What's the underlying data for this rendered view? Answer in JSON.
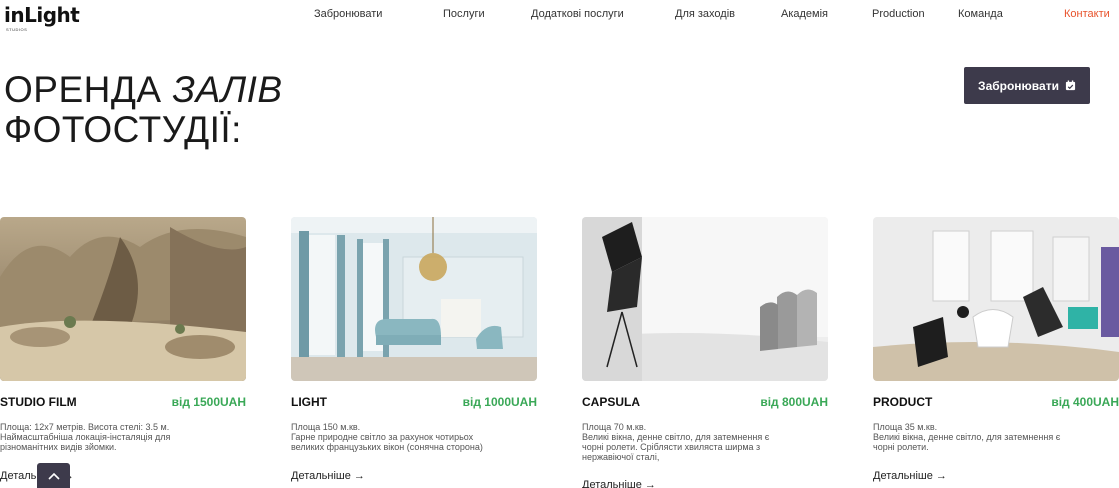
{
  "header": {
    "logo_text": "inLight",
    "logo_sub": "STUDIOS",
    "nav": [
      {
        "label": "Забронювати"
      },
      {
        "label": "Послуги"
      },
      {
        "label": "Додаткові послуги"
      },
      {
        "label": "Для заходів"
      },
      {
        "label": "Академія"
      },
      {
        "label": "Production"
      },
      {
        "label": "Команда"
      },
      {
        "label": "Контакти"
      }
    ]
  },
  "main": {
    "title_line1_a": "ОРЕНДА",
    "title_line1_b": "ЗАЛІВ",
    "title_line2": "ФОТОСТУДІЇ:",
    "cta_label": "Забронювати"
  },
  "colors": {
    "accent_dark": "#3d3a4b",
    "price_green": "#3aa857",
    "active_nav": "#e8532c"
  },
  "studios": [
    {
      "name": "STUDIO FILM",
      "price": "від 1500UAH",
      "desc": [
        "Площа: 12х7 метрів. Висота стелі: 3.5 м.",
        "Наймасштабніша локація-інсталяція для",
        "різноманітних видів зйомки."
      ],
      "more": "Детальніше →"
    },
    {
      "name": "LIGHT",
      "price": "від 1000UAH",
      "desc": [
        "Площа 150 м.кв.",
        "Гарне природне світло за рахунок чотирьох",
        "великих французьких вікон (сонячна сторона)"
      ],
      "more": "Детальніше →"
    },
    {
      "name": "CAPSULA",
      "price": "від 800UAH",
      "desc": [
        "Площа 70 м.кв.",
        "Великі вікна, денне світло, для затемнення є",
        "чорні ролети. Сріблясти хвиляста ширма з",
        "нержавіючої сталі,"
      ],
      "more": "Детальніше →"
    },
    {
      "name": "PRODUCT",
      "price": "від 400UAH",
      "desc": [
        "Площа 35 м.кв.",
        "Великі вікна, денне світло, для затемнення є",
        "чорні ролети."
      ],
      "more": "Детальніше →"
    }
  ]
}
